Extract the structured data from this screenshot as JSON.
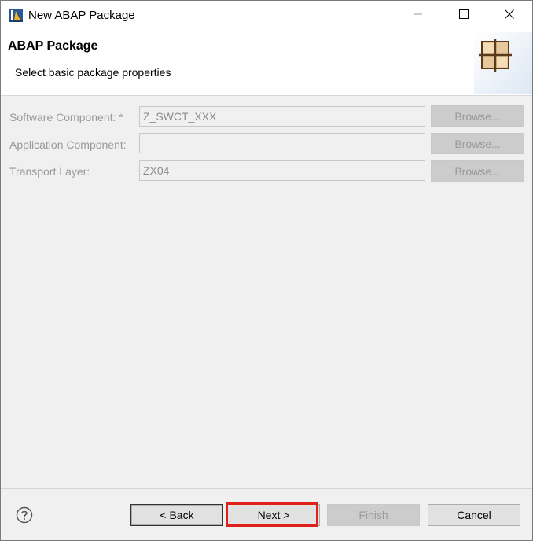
{
  "window": {
    "title": "New ABAP Package",
    "app_icon": "abap-package-app-icon",
    "controls": {
      "minimize_icon": "minimize-icon",
      "maximize_icon": "maximize-icon",
      "close_icon": "close-icon"
    }
  },
  "banner": {
    "title": "ABAP Package",
    "subtitle": "Select basic package properties",
    "image_icon": "package-wizard-icon"
  },
  "form": {
    "software_component": {
      "label": "Software Component: *",
      "value": "Z_SWCT_XXX",
      "browse_label": "Browse..."
    },
    "application_component": {
      "label": "Application Component:",
      "value": "",
      "browse_label": "Browse..."
    },
    "transport_layer": {
      "label": "Transport Layer:",
      "value": "ZX04",
      "browse_label": "Browse..."
    }
  },
  "footer": {
    "help_icon": "help-icon",
    "back_label": "< Back",
    "next_label": "Next >",
    "finish_label": "Finish",
    "cancel_label": "Cancel",
    "highlight_color": "#e0201b"
  },
  "colors": {
    "dialog_bg": "#f0f0f0",
    "disabled_text": "#9a9a9a",
    "disabled_button": "#cccccc"
  }
}
